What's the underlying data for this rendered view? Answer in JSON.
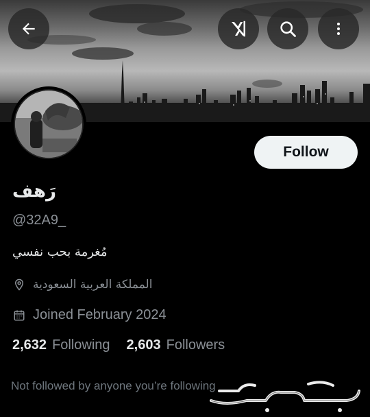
{
  "header": {
    "back_icon": "arrow-left-icon",
    "grok_icon": "grok-icon",
    "search_icon": "search-icon",
    "more_icon": "more-vertical-icon"
  },
  "profile": {
    "display_name": "رَهف",
    "handle": "@32A9_",
    "bio": "مُغرمة بحب نفسي",
    "location": "المملكة العربية السعودية",
    "joined": "Joined February 2024",
    "follow_label": "Follow"
  },
  "stats": {
    "following_count": "2,632",
    "following_label": "Following",
    "followers_count": "2,603",
    "followers_label": "Followers"
  },
  "footer": {
    "not_followed": "Not followed by anyone you’re following",
    "watermark": "حراج"
  },
  "colors": {
    "background": "#000000",
    "primary_text": "#e7e9ea",
    "secondary_text": "#8b9096",
    "follow_bg": "#eff3f4"
  }
}
